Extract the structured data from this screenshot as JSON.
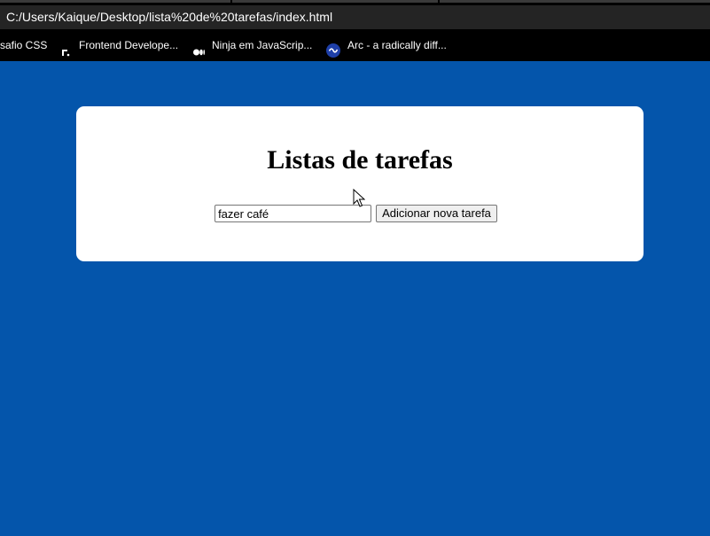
{
  "browser": {
    "address": "C:/Users/Kaique/Desktop/lista%20de%20tarefas/index.html",
    "bookmarks": [
      {
        "label": "safio CSS",
        "icon": "none"
      },
      {
        "label": "Frontend Develope...",
        "icon": "frontend-mentor-icon"
      },
      {
        "label": "Ninja em JavaScrip...",
        "icon": "medium-icon"
      },
      {
        "label": "Arc - a radically diff...",
        "icon": "arc-icon"
      }
    ]
  },
  "page": {
    "background_color": "#0455ab",
    "card_color": "#ffffff",
    "title": "Listas de tarefas",
    "task_input": {
      "value": "fazer café",
      "placeholder": ""
    },
    "add_button_label": "Adicionar nova tarefa"
  }
}
